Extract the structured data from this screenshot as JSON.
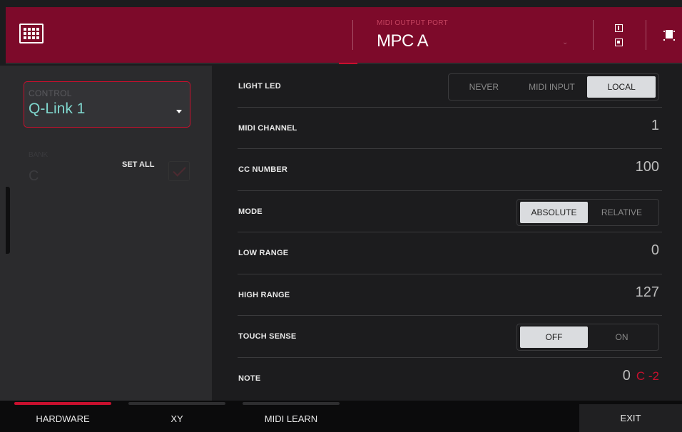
{
  "header": {
    "midi_output_port_label": "MIDI OUTPUT PORT",
    "midi_output_port_value": "MPC A"
  },
  "left": {
    "control_label": "CONTROL",
    "control_value": "Q-Link 1",
    "bank_label": "BANK",
    "bank_value": "C",
    "set_all_label": "SET ALL",
    "set_all_checked": true
  },
  "rows": {
    "light_led": {
      "label": "LIGHT LED",
      "options": [
        "NEVER",
        "MIDI INPUT",
        "LOCAL"
      ],
      "selected": "LOCAL"
    },
    "midi_channel": {
      "label": "MIDI CHANNEL",
      "value": "1"
    },
    "cc_number": {
      "label": "CC NUMBER",
      "value": "100"
    },
    "mode": {
      "label": "MODE",
      "options": [
        "ABSOLUTE",
        "RELATIVE"
      ],
      "selected": "ABSOLUTE"
    },
    "low_range": {
      "label": "LOW RANGE",
      "value": "0"
    },
    "high_range": {
      "label": "HIGH RANGE",
      "value": "127"
    },
    "touch_sense": {
      "label": "TOUCH SENSE",
      "options": [
        "OFF",
        "ON"
      ],
      "selected": "OFF"
    },
    "note": {
      "label": "NOTE",
      "value": "0",
      "note_name": "C -2"
    }
  },
  "bottom": {
    "tabs": [
      "HARDWARE",
      "XY",
      "MIDI LEARN"
    ],
    "active_tab": "HARDWARE",
    "exit_label": "EXIT"
  },
  "colors": {
    "header_bg": "#7d0a2a",
    "accent": "#c8102e",
    "control_value": "#7fd6cd"
  }
}
